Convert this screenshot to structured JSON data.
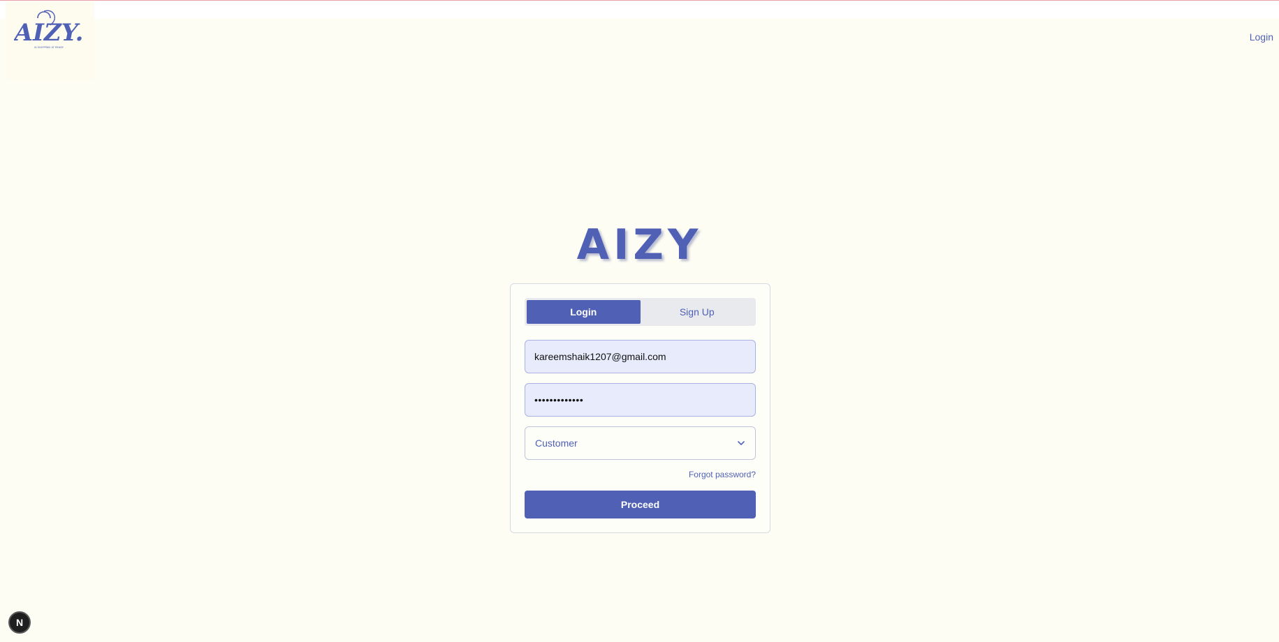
{
  "header": {
    "logo_text": "AIZY.",
    "logo_tagline": "AI SHOPPING AT READY",
    "login_link": "Login"
  },
  "brand": {
    "title": "AIZY"
  },
  "auth_form": {
    "tabs": [
      {
        "label": "Login",
        "active": true
      },
      {
        "label": "Sign Up",
        "active": false
      }
    ],
    "email_value": "kareemshaik1207@gmail.com",
    "password_value": "•••••••••••••",
    "role_select": {
      "selected": "Customer"
    },
    "forgot_password": "Forgot password?",
    "submit_label": "Proceed"
  },
  "dev_indicator": {
    "label": "N"
  },
  "colors": {
    "accent": "#4f60b5",
    "background": "#fdfdf4",
    "input_fill": "#e8ebfc"
  }
}
